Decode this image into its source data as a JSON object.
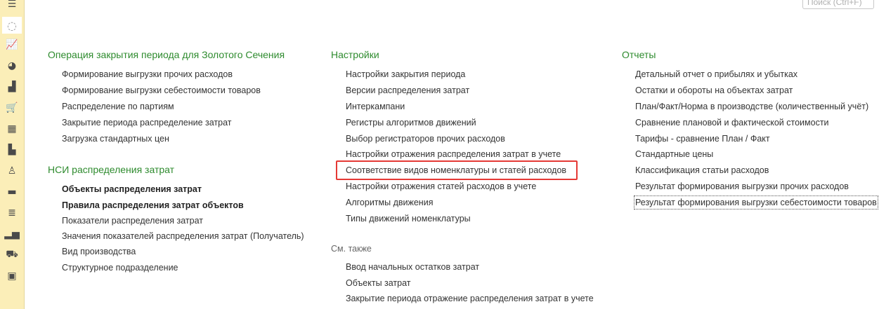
{
  "search": {
    "placeholder": "Поиск (Ctrl+F)"
  },
  "sidebar": {
    "items": [
      {
        "icon": "menu-icon",
        "glyph": "☰"
      },
      {
        "icon": "loading-spinner-icon",
        "glyph": "◌"
      },
      {
        "icon": "chart-settings-icon",
        "glyph": "📈"
      },
      {
        "icon": "pie-chart-icon",
        "glyph": "◕"
      },
      {
        "icon": "shopping-bag-icon",
        "glyph": "▟"
      },
      {
        "icon": "cart-icon",
        "glyph": "🛒"
      },
      {
        "icon": "grid-icon",
        "glyph": "▦"
      },
      {
        "icon": "warehouse-icon",
        "glyph": "▙"
      },
      {
        "icon": "person-icon",
        "glyph": "♙"
      },
      {
        "icon": "card-icon",
        "glyph": "▬"
      },
      {
        "icon": "documents-icon",
        "glyph": "≣"
      },
      {
        "icon": "bar-chart-icon",
        "glyph": "▂▅"
      },
      {
        "icon": "truck-icon",
        "glyph": "⛟"
      },
      {
        "icon": "box-icon",
        "glyph": "▣"
      }
    ]
  },
  "col1": {
    "section1": {
      "title": "Операция закрытия периода для Золотого Сечения",
      "items": [
        "Формирование выгрузки прочих расходов",
        "Формирование выгрузки себестоимости товаров",
        "Распределение по партиям",
        "Закрытие периода распределение затрат",
        "Загрузка стандартных цен"
      ]
    },
    "section2": {
      "title": "НСИ распределения затрат",
      "items": [
        "Объекты распределения затрат",
        "Правила распределения затрат объектов",
        "Показатели распределения затрат",
        "Значения показателей распределения затрат (Получатель)",
        "Вид производства",
        "Структурное подразделение"
      ]
    }
  },
  "col2": {
    "section1": {
      "title": "Настройки",
      "items": [
        "Настройки закрытия периода",
        "Версии распределения затрат",
        "Интеркампани",
        "Регистры алгоритмов движений",
        "Выбор регистраторов прочих расходов",
        "Настройки отражения распределения затрат в учете",
        "Соответствие видов номенклатуры и статей расходов",
        "Настройки отражения статей расходов в учете",
        "Алгоритмы движения",
        "Типы движений номенклатуры"
      ]
    },
    "see_also": {
      "title": "См. также",
      "items": [
        "Ввод начальных остатков затрат",
        "Объекты затрат",
        "Закрытие периода отражение распределения затрат в учете"
      ]
    }
  },
  "col3": {
    "section1": {
      "title": "Отчеты",
      "items": [
        "Детальный отчет о прибылях и убытках",
        "Остатки и обороты на объектах затрат",
        "План/Факт/Норма в производстве (количественный учёт)",
        "Сравнение плановой и фактической стоимости",
        "Тарифы - сравнение План / Факт",
        "Стандартные цены",
        "Классификация статьи расходов",
        "Результат формирования выгрузки прочих расходов",
        "Результат формирования выгрузки себестоимости товаров"
      ]
    }
  },
  "colors": {
    "section_title": "#2e8b2e",
    "sidebar_bg": "#fbeeb8",
    "highlight_border": "#e53935"
  }
}
